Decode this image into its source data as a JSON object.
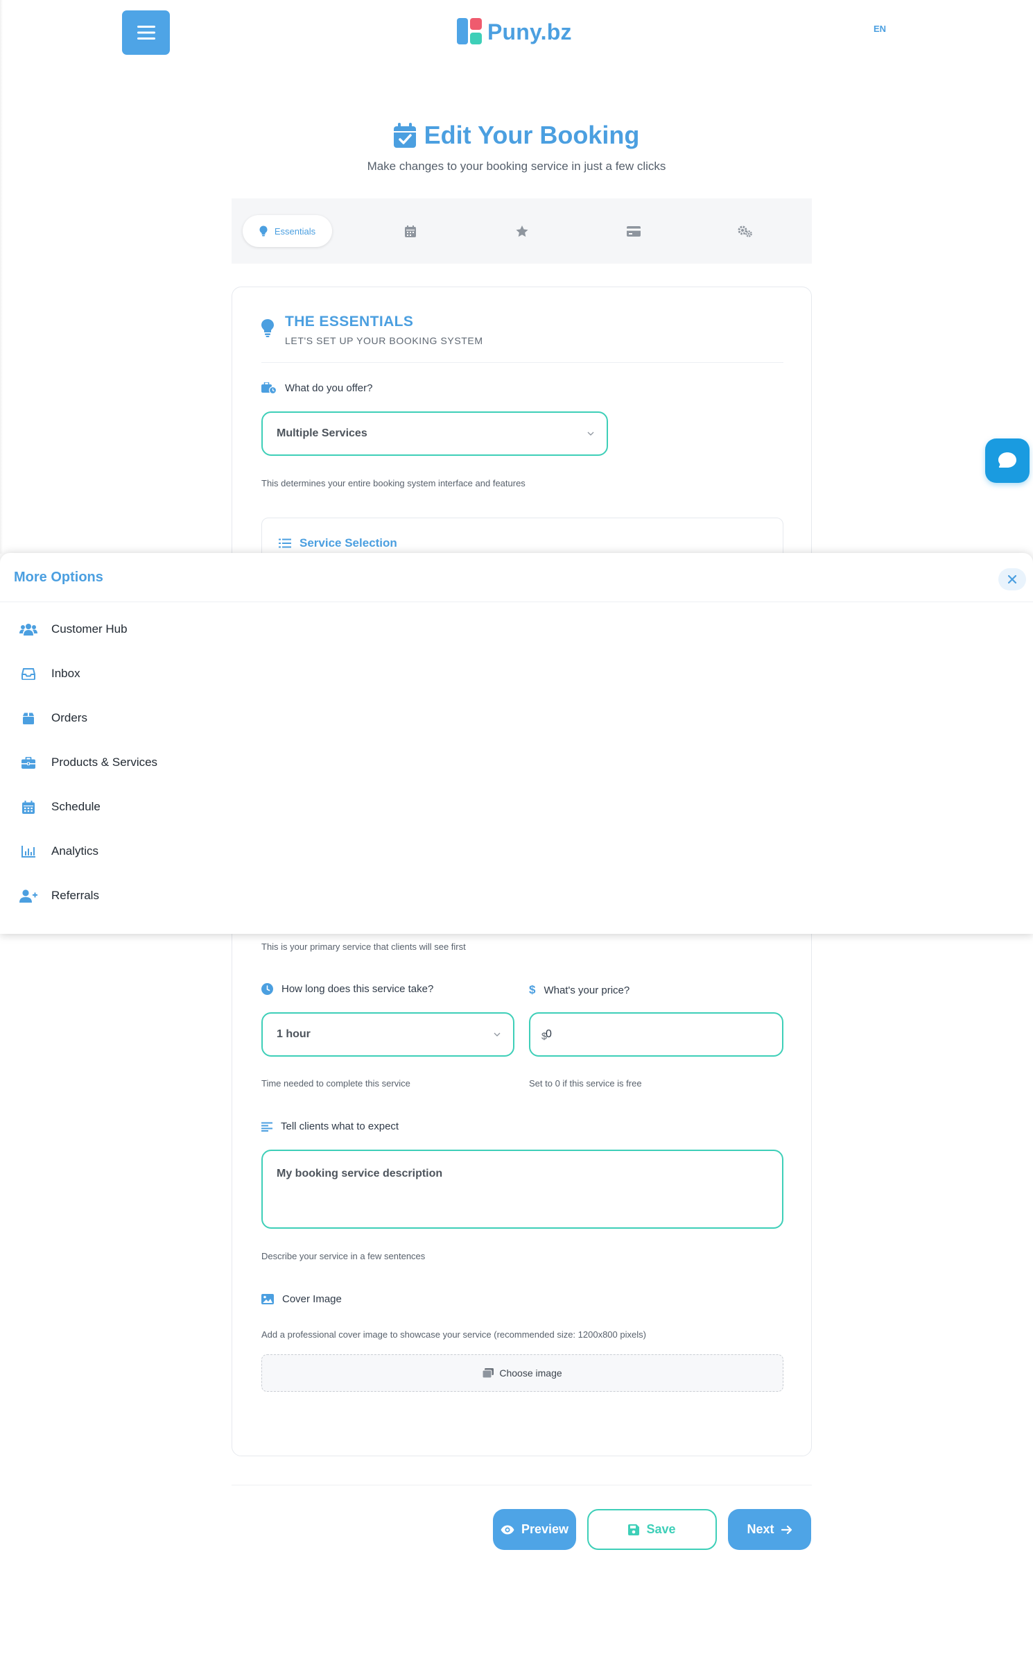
{
  "header": {
    "brand": "Puny.bz",
    "language": "EN"
  },
  "page": {
    "title": "Edit Your Booking",
    "subtitle": "Make changes to your booking service in just a few clicks"
  },
  "tabs": [
    {
      "label": "Essentials",
      "icon": "lightbulb-icon",
      "active": true
    },
    {
      "label": "",
      "icon": "calendar-icon"
    },
    {
      "label": "",
      "icon": "star-icon"
    },
    {
      "label": "",
      "icon": "credit-card-icon"
    },
    {
      "label": "",
      "icon": "gears-icon"
    }
  ],
  "essentials": {
    "title": "THE ESSENTIALS",
    "subtitle": "LET'S SET UP YOUR BOOKING SYSTEM",
    "offer_label": "What do you offer?",
    "offer_value": "Multiple Services",
    "offer_hint": "This determines your entire booking system interface and features",
    "service_selection_label": "Service Selection",
    "primary_hint": "This is your primary service that clients will see first",
    "duration_label": "How long does this service take?",
    "duration_value": "1 hour",
    "duration_hint": "Time needed to complete this service",
    "price_label": "What's your price?",
    "price_value": "0",
    "price_hint": "Set to 0 if this service is free",
    "description_label": "Tell clients what to expect",
    "description_value": "My booking service description",
    "description_hint": "Describe your service in a few sentences",
    "cover_label": "Cover Image",
    "cover_hint": "Add a professional cover image to showcase your service (recommended size: 1200x800 pixels)",
    "cover_button": "Choose image"
  },
  "more_options": {
    "title": "More Options",
    "items": [
      {
        "label": "Customer Hub",
        "icon": "users-icon"
      },
      {
        "label": "Inbox",
        "icon": "inbox-icon"
      },
      {
        "label": "Orders",
        "icon": "orders-box-icon"
      },
      {
        "label": "Products & Services",
        "icon": "briefcase-icon"
      },
      {
        "label": "Schedule",
        "icon": "calendar-icon"
      },
      {
        "label": "Analytics",
        "icon": "bar-chart-icon"
      },
      {
        "label": "Referrals",
        "icon": "user-plus-icon"
      }
    ]
  },
  "actions": {
    "preview": "Preview",
    "save": "Save",
    "next": "Next"
  },
  "colors": {
    "primary": "#4b9fe0",
    "accent": "#3ecfb8",
    "chat": "#1a9be0"
  }
}
